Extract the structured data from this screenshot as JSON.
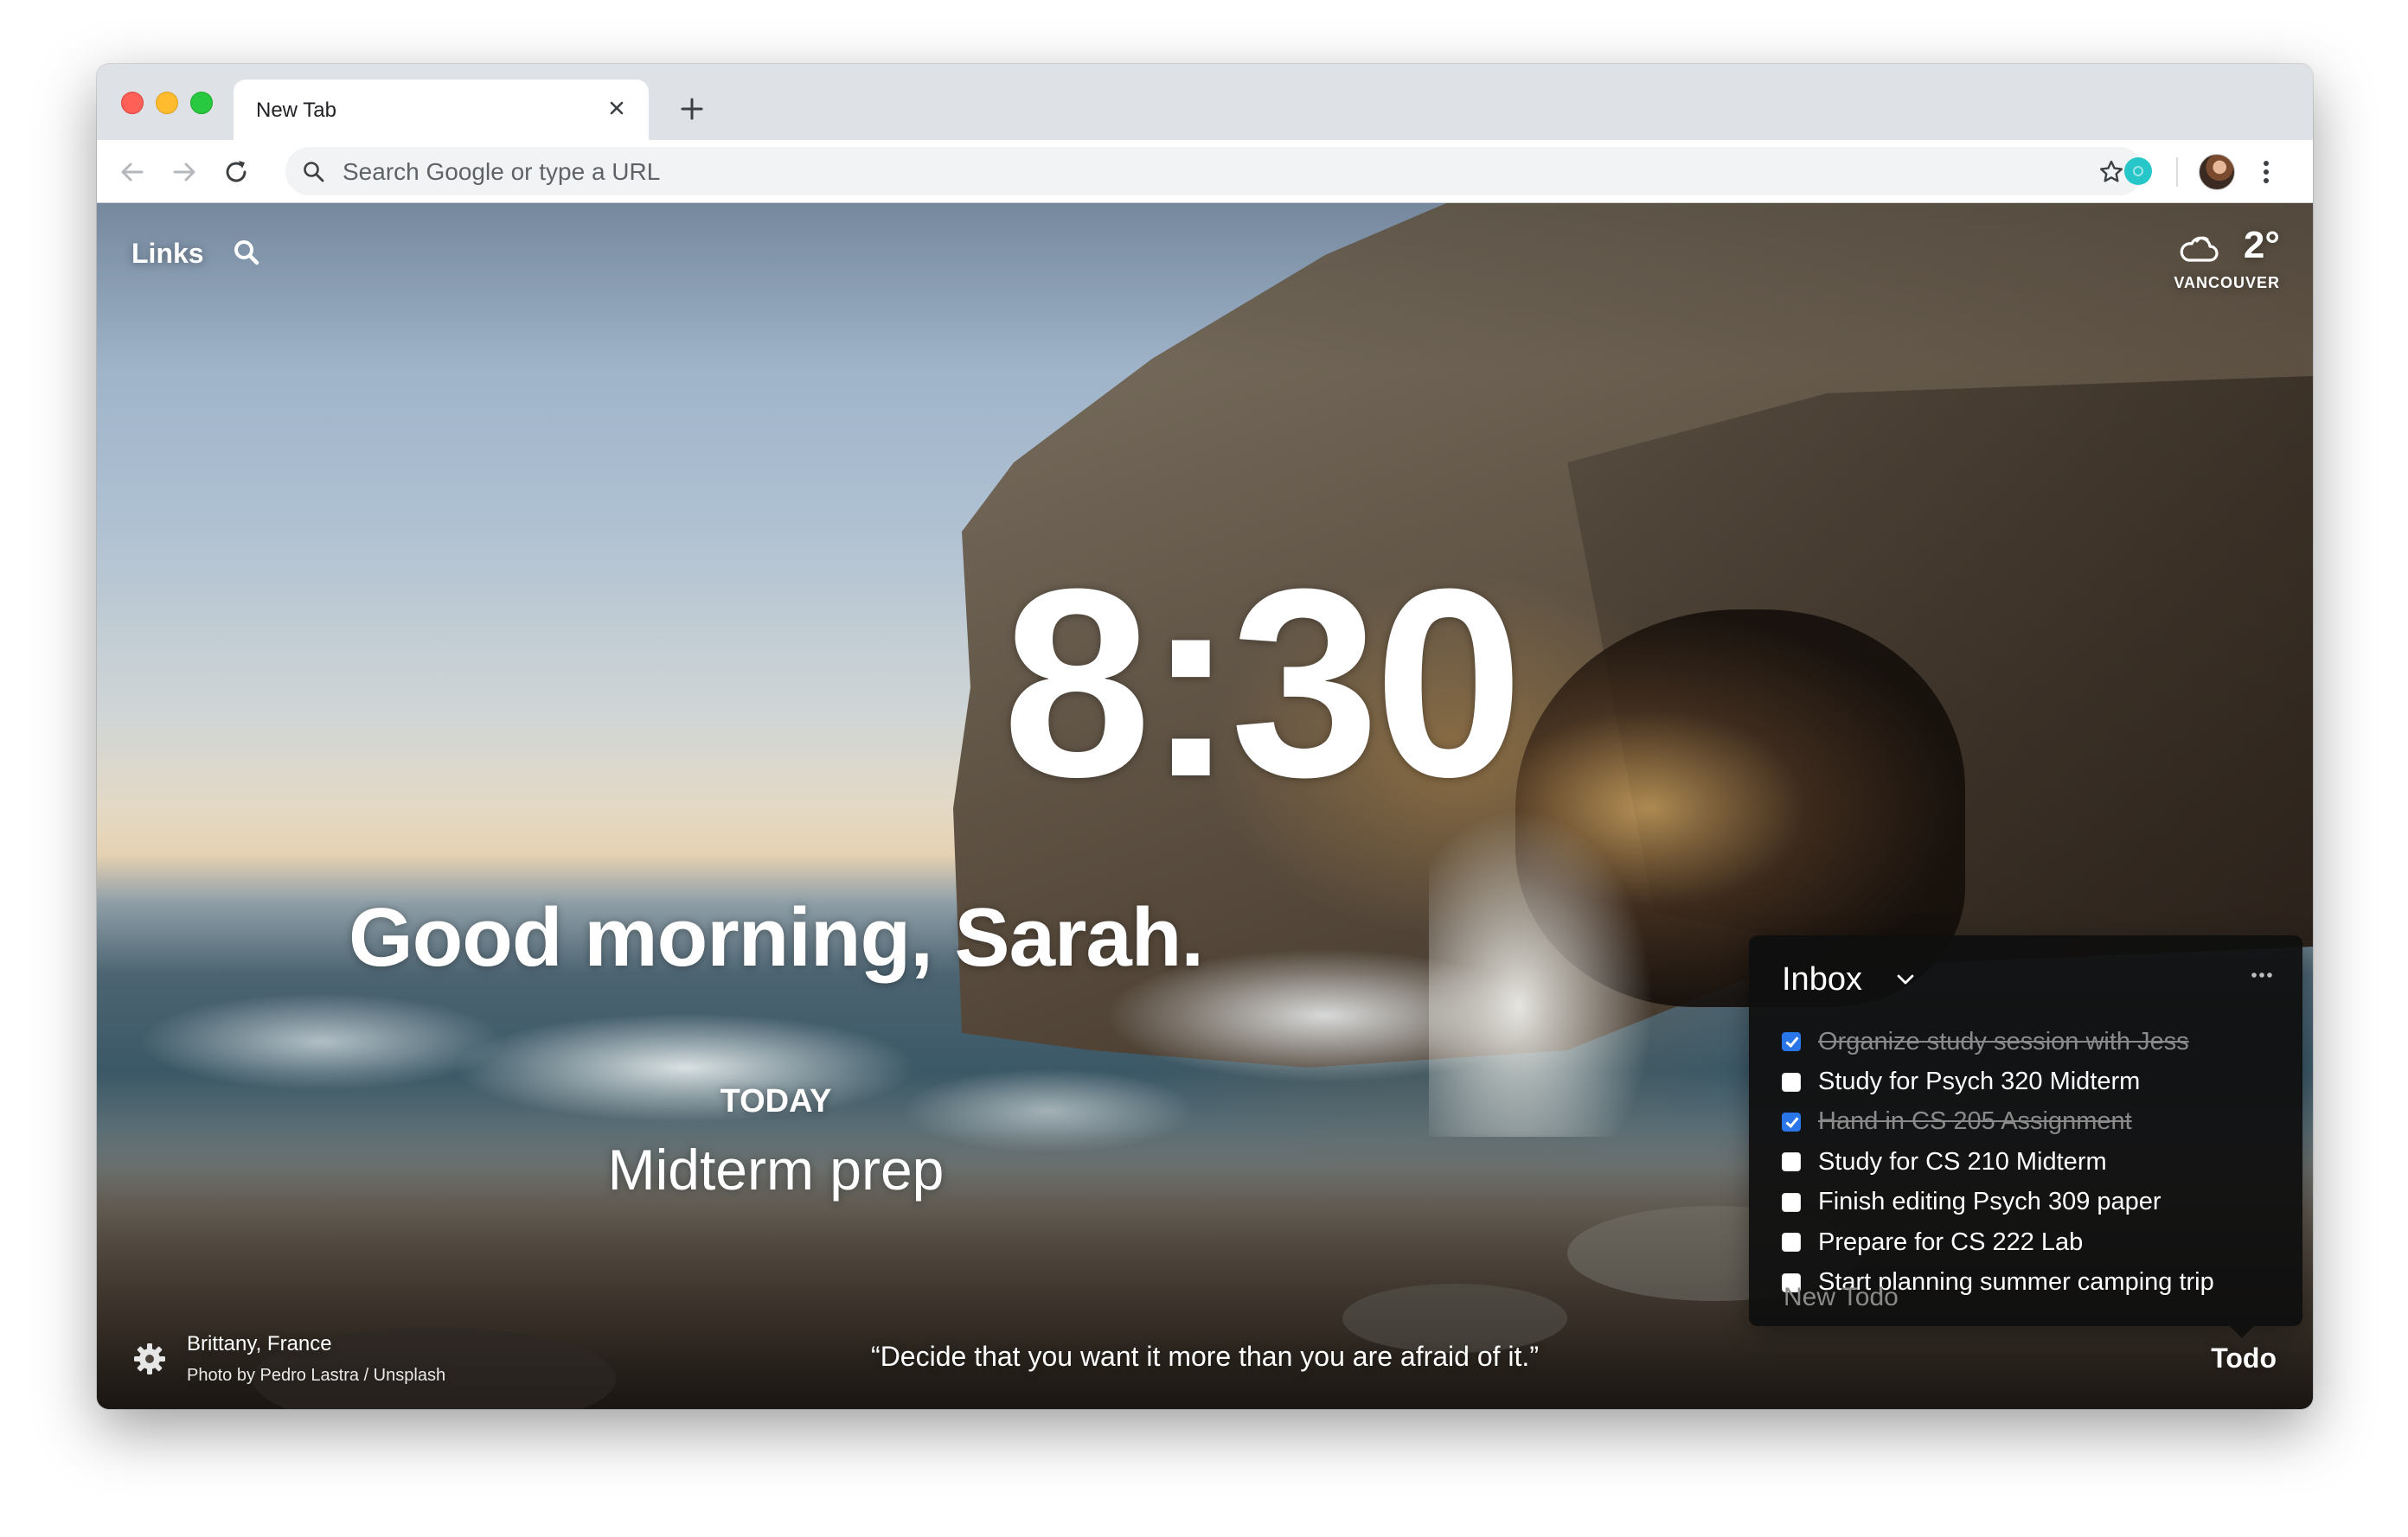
{
  "browser": {
    "tab_title": "New Tab",
    "omnibox_placeholder": "Search Google or type a URL"
  },
  "dashboard": {
    "links_label": "Links",
    "weather": {
      "temperature": "2°",
      "location": "VANCOUVER",
      "icon": "cloud-icon"
    },
    "clock": "8:30",
    "greeting": "Good morning, Sarah.",
    "focus": {
      "label": "TODAY",
      "text": "Midterm prep"
    },
    "photo": {
      "location": "Brittany, France",
      "credit": "Photo by Pedro Lastra / Unsplash"
    },
    "quote": "“Decide that you want it more than you are afraid of it.”",
    "todo_link": "Todo"
  },
  "todo_panel": {
    "title": "Inbox",
    "new_todo_placeholder": "New Todo",
    "items": [
      {
        "text": "Organize study session with Jess",
        "done": true
      },
      {
        "text": "Study for Psych 320 Midterm",
        "done": false
      },
      {
        "text": "Hand in CS 205 Assignment",
        "done": true
      },
      {
        "text": "Study for CS 210 Midterm",
        "done": false
      },
      {
        "text": "Finish editing Psych 309 paper",
        "done": false
      },
      {
        "text": "Prepare for CS 222 Lab",
        "done": false
      },
      {
        "text": "Start planning summer camping trip",
        "done": false
      }
    ]
  },
  "colors": {
    "checkbox_checked": "#2a76e8",
    "extension_icon": "#26c6c9",
    "traffic_red": "#fe5f57",
    "traffic_yellow": "#febc2e",
    "traffic_green": "#28c840"
  }
}
